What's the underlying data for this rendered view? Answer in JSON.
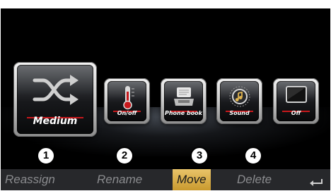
{
  "tiles": {
    "main": {
      "label": "Medium",
      "icon": "shuffle-icon"
    },
    "small": [
      {
        "label": "On/off",
        "icon": "thermometer-icon"
      },
      {
        "label": "Phone book",
        "icon": "phone-book-icon"
      },
      {
        "label": "Sound",
        "icon": "sound-knob-icon"
      },
      {
        "label": "Off",
        "icon": "display-off-icon"
      }
    ]
  },
  "callouts": [
    "1",
    "2",
    "3",
    "4"
  ],
  "softkeys": [
    {
      "label": "Reassign",
      "active": false
    },
    {
      "label": "Rename",
      "active": false
    },
    {
      "label": "Move",
      "active": true
    },
    {
      "label": "Delete",
      "active": false
    }
  ],
  "back_icon": "back-arrow-icon",
  "colors": {
    "accent": "#c8181c",
    "highlight": "#e0b44f",
    "background": "#000000"
  }
}
